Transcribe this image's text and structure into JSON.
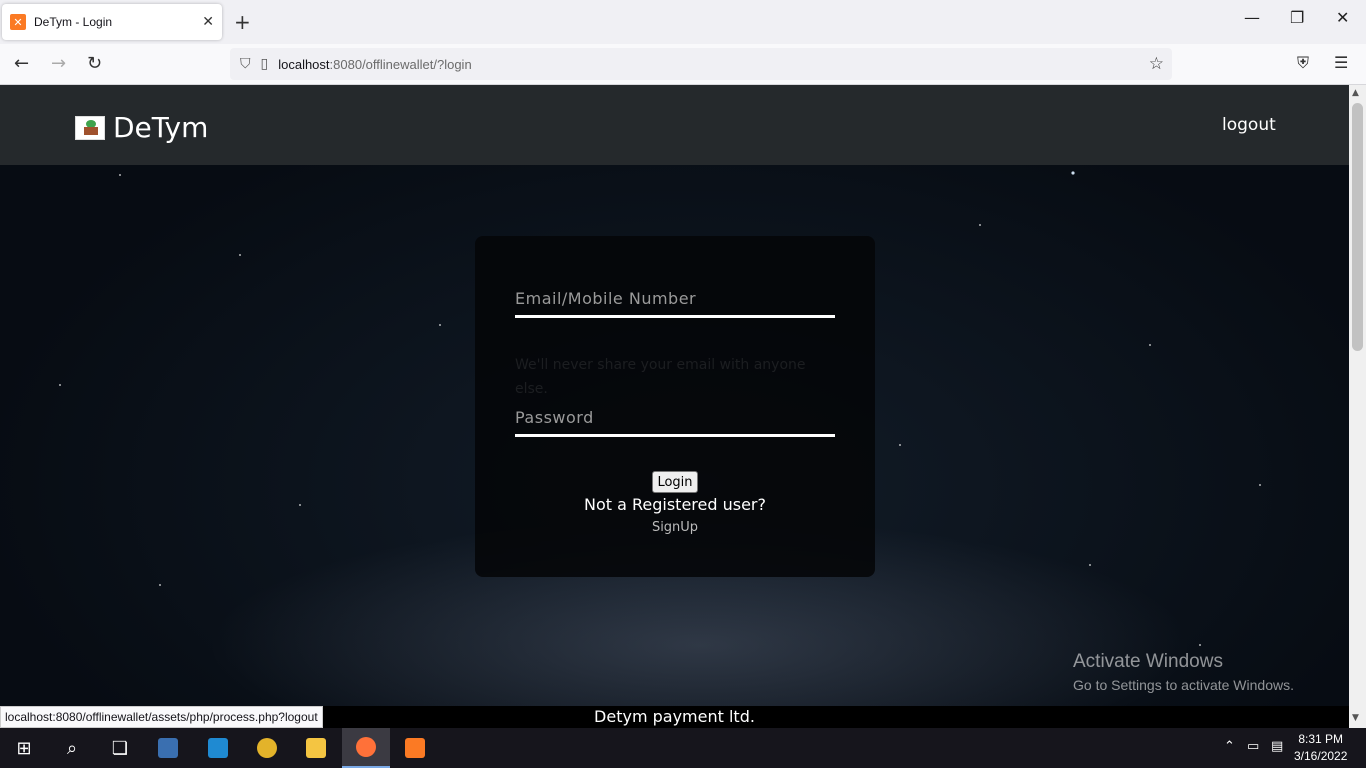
{
  "browser": {
    "tab_title": "DeTym - Login",
    "url_host": "localhost",
    "url_rest": ":8080/offlinewallet/?login",
    "status_url": "localhost:8080/offlinewallet/assets/php/process.php?logout"
  },
  "site": {
    "brand": "DeTym",
    "nav_logout": "logout"
  },
  "login": {
    "email_placeholder": "Email/Mobile Number",
    "helper_text": "We'll never share your email with anyone else.",
    "password_placeholder": "Password",
    "login_button": "Login",
    "not_registered": "Not a Registered user?",
    "signup_link": "SignUp"
  },
  "footer": {
    "text": "Detym payment ltd."
  },
  "watermark": {
    "title": "Activate Windows",
    "subtitle": "Go to Settings to activate Windows."
  },
  "taskbar": {
    "time": "8:31 PM",
    "date": "3/16/2022"
  },
  "colors": {
    "header_bg": "#25292c",
    "card_bg": "#050608",
    "accent_orange": "#fb7a24"
  }
}
